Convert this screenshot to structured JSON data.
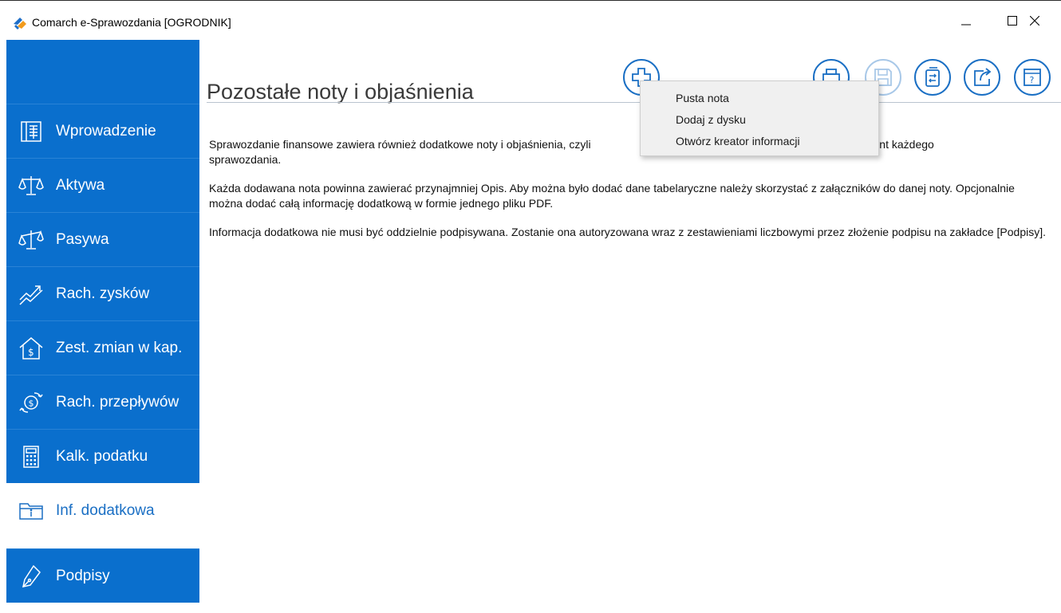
{
  "window": {
    "title": "Comarch e-Sprawozdania [OGRODNIK]"
  },
  "sidebar": {
    "items": [
      {
        "label": "Wprowadzenie",
        "icon": "book-icon"
      },
      {
        "label": "Aktywa",
        "icon": "scales-icon"
      },
      {
        "label": "Pasywa",
        "icon": "scales-tilted-icon"
      },
      {
        "label": "Rach. zysków",
        "icon": "chart-up-icon"
      },
      {
        "label": "Zest. zmian w kap.",
        "icon": "house-dollar-icon"
      },
      {
        "label": "Rach. przepływów",
        "icon": "money-flow-icon"
      },
      {
        "label": "Kalk. podatku",
        "icon": "calculator-icon"
      },
      {
        "label": "Inf. dodatkowa",
        "icon": "folder-info-icon",
        "active": true
      },
      {
        "label": "Podpisy",
        "icon": "pen-icon"
      }
    ],
    "active_color": "#1a6fc4",
    "background_color": "#0a6fcd"
  },
  "header": {
    "title": "Pozostałe noty i objaśnienia",
    "toolbar": [
      "add-icon",
      "print-icon",
      "save-icon",
      "copy-icon",
      "share-icon",
      "help-window-icon"
    ]
  },
  "popup_menu": {
    "items": [
      "Pusta nota",
      "Dodaj z dysku",
      "Otwórz kreator informacji"
    ]
  },
  "content": {
    "paragraphs": [
      "Sprawozdanie finansowe zawiera również dodatkowe noty i objaśnienia, czyli … kowy element każdego sprawozdania.",
      "Każda dodawana nota powinna zawierać przynajmniej Opis. Aby można było dodać dane tabelaryczne należy skorzystać z załączników do danej noty. Opcjonalnie można dodać całą informację dodatkową w formie jednego pliku PDF.",
      "Informacja dodatkowa nie musi być oddzielnie podpisywana. Zostanie ona autoryzowana wraz z zestawieniami liczbowymi przez złożenie podpisu na zakładce [Podpisy]."
    ],
    "p1_visible_left": "Sprawozdanie finansowe zawiera również dodatkowe noty i objaśnienia, czyli",
    "p1_visible_right": "kowy element każdego",
    "p1_line2": "sprawozdania."
  }
}
